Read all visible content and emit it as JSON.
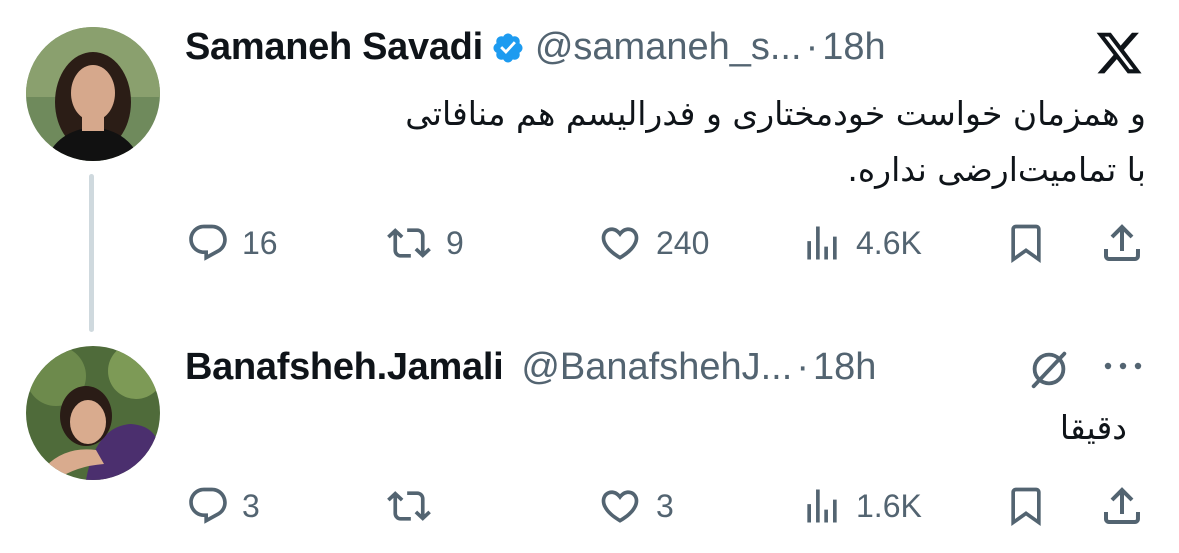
{
  "tweets": [
    {
      "author_name": "Samaneh Savadi",
      "handle": "@samaneh_s...",
      "separator": "·",
      "time": "18h",
      "verified": true,
      "text_lines": [
        "و همزمان خواست خودمختاری و فدرالیسم هم منافاتی",
        "با تمامیت‌ارضی نداره."
      ],
      "replies": "16",
      "reposts": "9",
      "likes": "240",
      "views": "4.6K",
      "corner_icon": "x-logo-icon"
    },
    {
      "author_name": "Banafsheh.Jamali",
      "handle": "@BanafshehJ...",
      "separator": "·",
      "time": "18h",
      "verified": false,
      "text_lines": [
        "دقیقا"
      ],
      "replies": "3",
      "reposts": "",
      "likes": "3",
      "views": "1.6K",
      "corner_icon": "grok-icon"
    }
  ],
  "colors": {
    "text": "#0f1419",
    "secondary": "#536471",
    "verified_badge": "#1d9bf0",
    "thread_line": "#cfd9de"
  }
}
